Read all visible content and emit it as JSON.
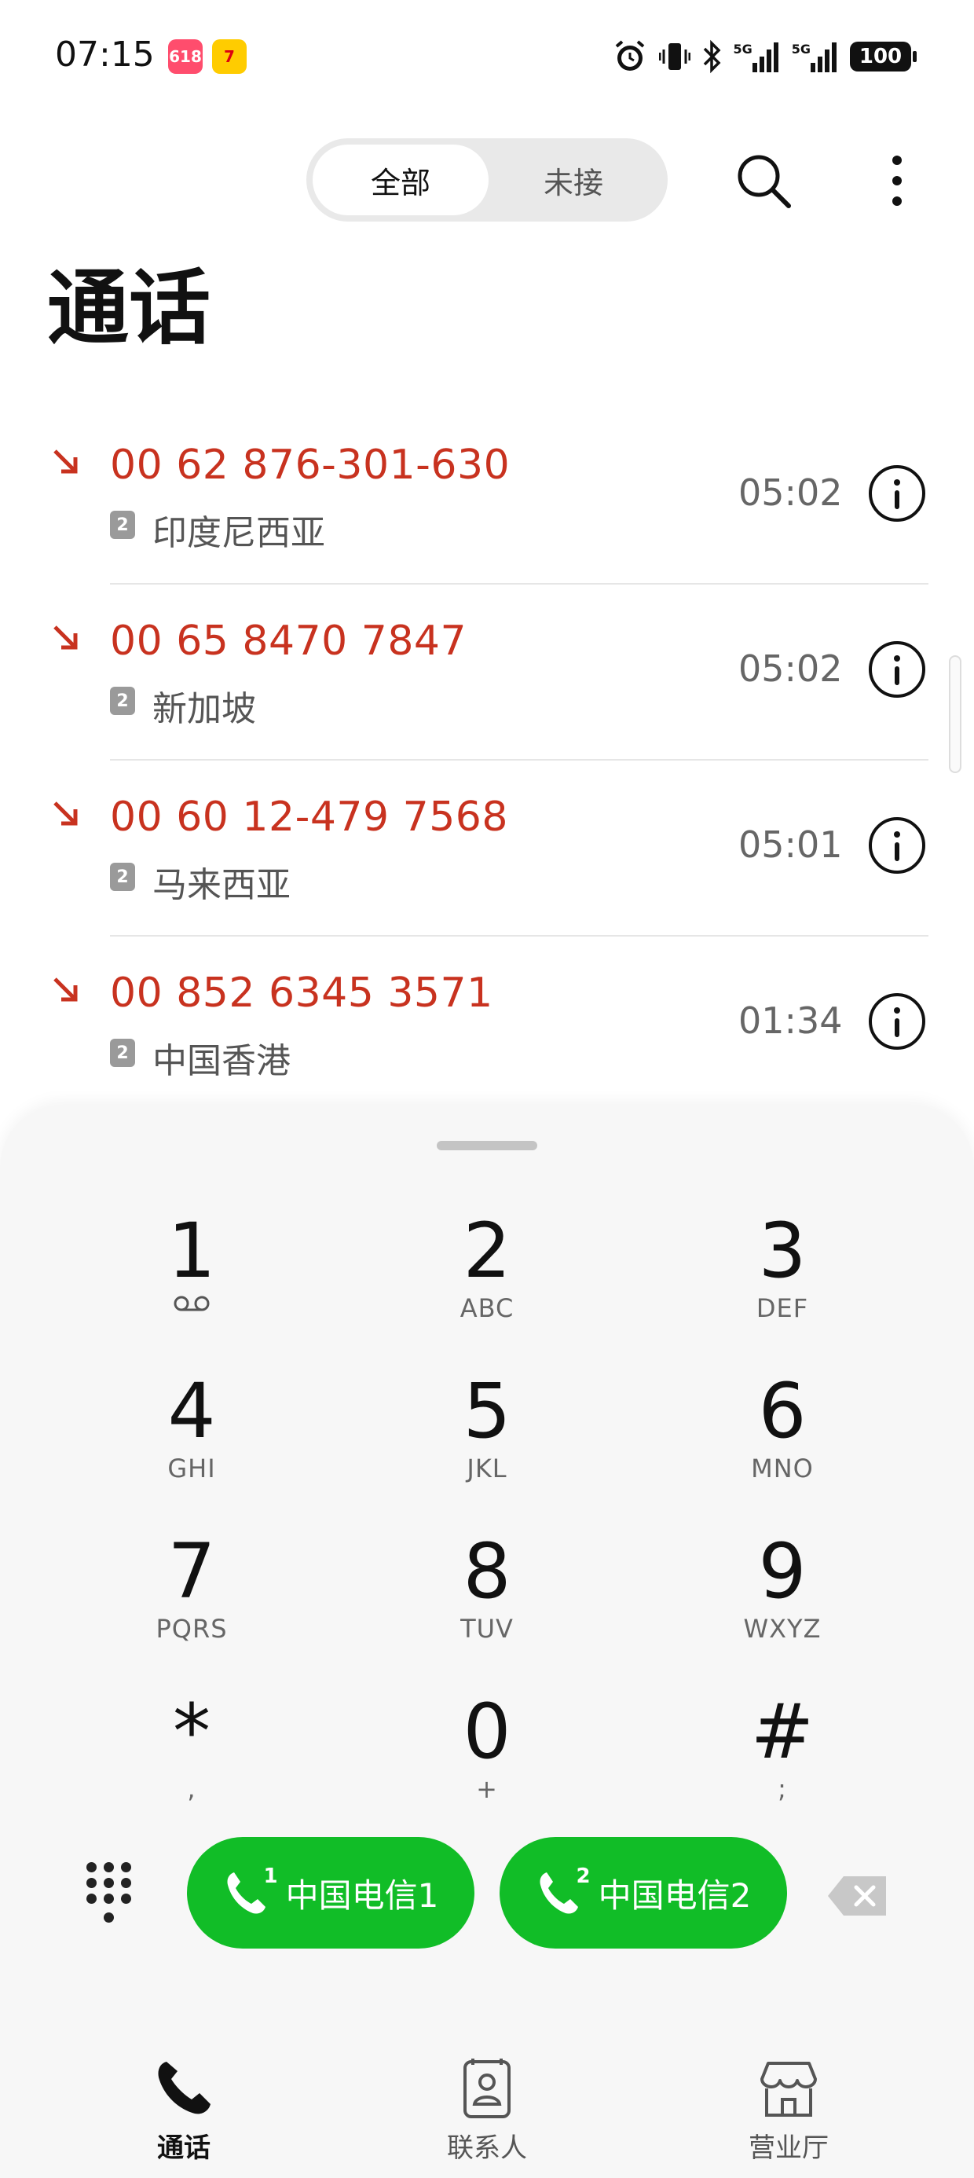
{
  "status_bar": {
    "time": "07:15",
    "app_badges": [
      "618",
      "7"
    ],
    "network_labels": [
      "5G",
      "5G"
    ],
    "battery": "100"
  },
  "header": {
    "segments": [
      "全部",
      "未接"
    ],
    "selected_segment": "全部",
    "title": "通话"
  },
  "calls": [
    {
      "number": "00 62 876-301-630",
      "sim": "2",
      "location": "印度尼西亚",
      "time": "05:02"
    },
    {
      "number": "00 65 8470 7847",
      "sim": "2",
      "location": "新加坡",
      "time": "05:02"
    },
    {
      "number": "00 60 12-479 7568",
      "sim": "2",
      "location": "马来西亚",
      "time": "05:01"
    },
    {
      "number": "00 852 6345 3571",
      "sim": "2",
      "location": "中国香港",
      "time": "01:34"
    }
  ],
  "dialpad": {
    "keys": [
      {
        "digit": "1",
        "sub": ""
      },
      {
        "digit": "2",
        "sub": "ABC"
      },
      {
        "digit": "3",
        "sub": "DEF"
      },
      {
        "digit": "4",
        "sub": "GHI"
      },
      {
        "digit": "5",
        "sub": "JKL"
      },
      {
        "digit": "6",
        "sub": "MNO"
      },
      {
        "digit": "7",
        "sub": "PQRS"
      },
      {
        "digit": "8",
        "sub": "TUV"
      },
      {
        "digit": "9",
        "sub": "WXYZ"
      },
      {
        "digit": "*",
        "sub": ","
      },
      {
        "digit": "0",
        "sub": "+"
      },
      {
        "digit": "#",
        "sub": ";"
      }
    ],
    "call_buttons": [
      {
        "sim": "1",
        "label": "中国电信1"
      },
      {
        "sim": "2",
        "label": "中国电信2"
      }
    ]
  },
  "bottom_nav": {
    "items": [
      {
        "label": "通话",
        "icon": "phone-icon",
        "active": true
      },
      {
        "label": "联系人",
        "icon": "contacts-icon",
        "active": false
      },
      {
        "label": "营业厅",
        "icon": "store-icon",
        "active": false
      }
    ]
  },
  "colors": {
    "missed_red": "#c8321f",
    "call_green": "#11bd27",
    "sheet_bg": "#f7f7f7"
  }
}
